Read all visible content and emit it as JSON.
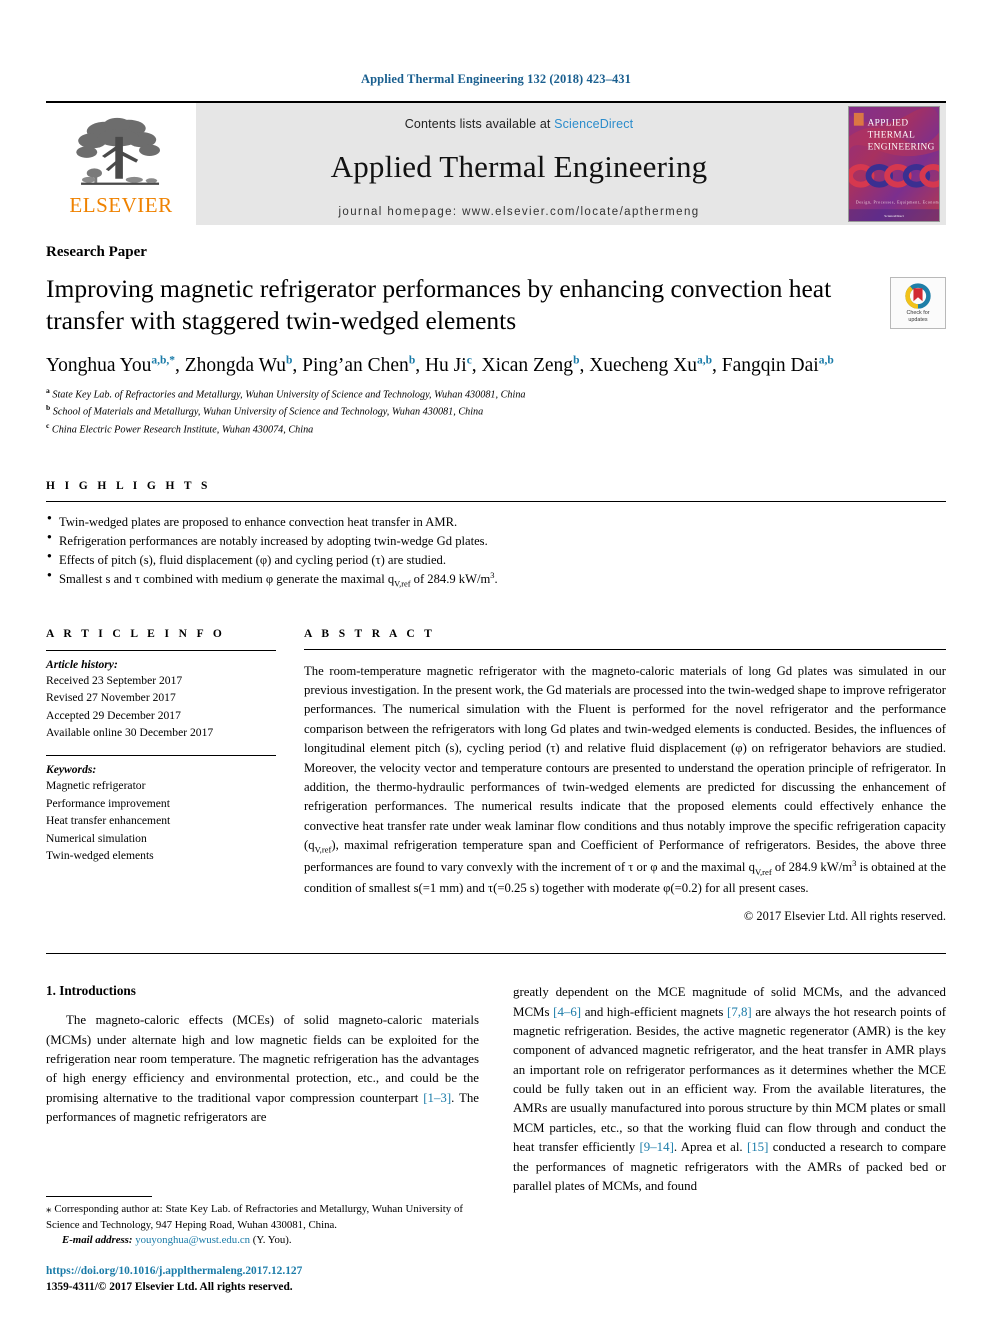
{
  "running_head": "Applied Thermal Engineering 132 (2018) 423–431",
  "masthead": {
    "publisher_name": "ELSEVIER",
    "contents_prefix": "Contents lists available at ",
    "sciencedirect": "ScienceDirect",
    "journal_title": "Applied Thermal Engineering",
    "homepage": "journal homepage: www.elsevier.com/locate/apthermeng",
    "cover": {
      "line1": "APPLIED",
      "line2": "THERMAL",
      "line3": "ENGINEERING",
      "tagline": "Design, Processes, Equipment, Economics",
      "colors": {
        "top": "#8e2f5e",
        "mid": "#7a2f86",
        "bottom": "#b03a57",
        "accent": "#3a2f8e"
      }
    }
  },
  "article": {
    "type_label": "Research Paper",
    "title": "Improving magnetic refrigerator performances by enhancing convection heat transfer with staggered twin-wedged elements",
    "crossmark": {
      "line1": "Check for",
      "line2": "updates"
    },
    "authors": [
      {
        "name": "Yonghua You",
        "sup": "a,b,*"
      },
      {
        "name": "Zhongda Wu",
        "sup": "b"
      },
      {
        "name": "Ping’an Chen",
        "sup": "b"
      },
      {
        "name": "Hu Ji",
        "sup": "c"
      },
      {
        "name": "Xican Zeng",
        "sup": "b"
      },
      {
        "name": "Xuecheng Xu",
        "sup": "a,b"
      },
      {
        "name": "Fangqin Dai",
        "sup": "a,b"
      }
    ],
    "affiliations": [
      {
        "mark": "a",
        "text": "State Key Lab. of Refractories and Metallurgy, Wuhan University of Science and Technology, Wuhan 430081, China"
      },
      {
        "mark": "b",
        "text": "School of Materials and Metallurgy, Wuhan University of Science and Technology, Wuhan 430081, China"
      },
      {
        "mark": "c",
        "text": "China Electric Power Research Institute, Wuhan 430074, China"
      }
    ]
  },
  "highlights": {
    "heading": "H I G H L I G H T S",
    "items": [
      "Twin-wedged plates are proposed to enhance convection heat transfer in AMR.",
      "Refrigeration performances are notably increased by adopting twin-wedge Gd plates.",
      "Effects of pitch (s), fluid displacement (φ) and cycling period (τ) are studied.",
      "Smallest s and τ combined with medium φ generate the maximal qV,ref of 284.9 kW/m3."
    ]
  },
  "article_info": {
    "heading": "A R T I C L E   I N F O",
    "history_label": "Article history:",
    "history": [
      "Received 23 September 2017",
      "Revised 27 November 2017",
      "Accepted 29 December 2017",
      "Available online 30 December 2017"
    ],
    "keywords_label": "Keywords:",
    "keywords": [
      "Magnetic refrigerator",
      "Performance improvement",
      "Heat transfer enhancement",
      "Numerical simulation",
      "Twin-wedged elements"
    ]
  },
  "abstract": {
    "heading": "A B S T R A C T",
    "text": "The room-temperature magnetic refrigerator with the magneto-caloric materials of long Gd plates was simulated in our previous investigation. In the present work, the Gd materials are processed into the twin-wedged shape to improve refrigerator performances. The numerical simulation with the Fluent is performed for the novel refrigerator and the performance comparison between the refrigerators with long Gd plates and twin-wedged elements is conducted. Besides, the influences of longitudinal element pitch (s), cycling period (τ) and relative fluid displacement (φ) on refrigerator behaviors are studied. Moreover, the velocity vector and temperature contours are presented to understand the operation principle of refrigerator. In addition, the thermo-hydraulic performances of twin-wedged elements are predicted for discussing the enhancement of refrigeration performances. The numerical results indicate that the proposed elements could effectively enhance the convective heat transfer rate under weak laminar flow conditions and thus notably improve the specific refrigeration capacity (qV,ref), maximal refrigeration temperature span and Coefficient of Performance of refrigerators. Besides, the above three performances are found to vary convexly with the increment of τ or φ and the maximal qV,ref of 284.9 kW/m3 is obtained at the condition of smallest s(=1 mm) and τ(=0.25 s) together with moderate φ(=0.2) for all present cases.",
    "copyright": "© 2017 Elsevier Ltd. All rights reserved."
  },
  "body": {
    "section_number_title": "1. Introductions",
    "left_paragraph": "The magneto-caloric effects (MCEs) of solid magneto-caloric materials (MCMs) under alternate high and low magnetic fields can be exploited for the refrigeration near room temperature. The magnetic refrigeration has the advantages of high energy efficiency and environmental protection, etc., and could be the promising alternative to the traditional vapor compression counterpart [1–3]. The performances of magnetic refrigerators are",
    "left_cite": "[1–3]",
    "right_paragraph": "greatly dependent on the MCE magnitude of solid MCMs, and the advanced MCMs [4–6] and high-efficient magnets [7,8] are always the hot research points of magnetic refrigeration. Besides, the active magnetic regenerator (AMR) is the key component of advanced magnetic refrigerator, and the heat transfer in AMR plays an important role on refrigerator performances as it determines whether the MCE could be fully taken out in an efficient way. From the available literatures, the AMRs are usually manufactured into porous structure by thin MCM plates or small MCM particles, etc., so that the working fluid can flow through and conduct the heat transfer efficiently [9–14]. Aprea et al. [15] conducted a research to compare the performances of magnetic refrigerators with the AMRs of packed bed or parallel plates of MCMs, and found",
    "right_cites": [
      "[4–6]",
      "[7,8]",
      "[9–14]",
      "[15]"
    ]
  },
  "footnote": {
    "star": "⁎",
    "corresponding": "Corresponding author at: State Key Lab. of Refractories and Metallurgy, Wuhan University of Science and Technology, 947 Heping Road, Wuhan 430081, China.",
    "email_label": "E-mail address:",
    "email": "youyonghua@wust.edu.cn",
    "email_owner": "(Y. You).",
    "doi": "https://doi.org/10.1016/j.applthermaleng.2017.12.127",
    "issn": "1359-4311/© 2017 Elsevier Ltd. All rights reserved."
  },
  "colors": {
    "link": "#1a7ba8",
    "sciencedirect": "#2b8ccc",
    "running_head": "#1a5f8f",
    "elsevier_orange": "#ef8200",
    "masthead_grey": "#e6e6e6"
  }
}
